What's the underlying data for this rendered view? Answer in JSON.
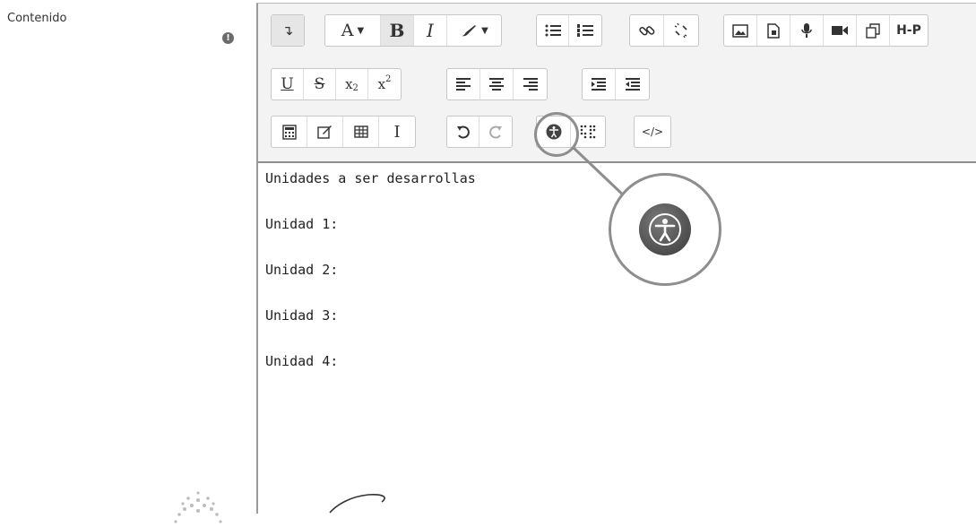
{
  "form": {
    "field_label": "Contenido",
    "required_icon_text": "!"
  },
  "toolbar": {
    "row1": {
      "collapse": "↴",
      "font_color": "A",
      "bold": "B",
      "italic": "I",
      "h5p": "H-P"
    },
    "row2": {
      "underline": "U",
      "strikethrough": "S",
      "subscript": "x",
      "subscript_index": "2",
      "superscript": "x",
      "superscript_index": "2"
    },
    "row3": {
      "spellcheck": "I",
      "html": "</>"
    }
  },
  "content": {
    "lines": [
      "Unidades a ser desarrollas",
      "Unidad 1:",
      "Unidad 2:",
      "Unidad 3:",
      "Unidad 4:"
    ]
  },
  "colors": {
    "toolbar_bg": "#f3f3f3",
    "callout_border": "#8e8e8e",
    "text": "#222222"
  }
}
